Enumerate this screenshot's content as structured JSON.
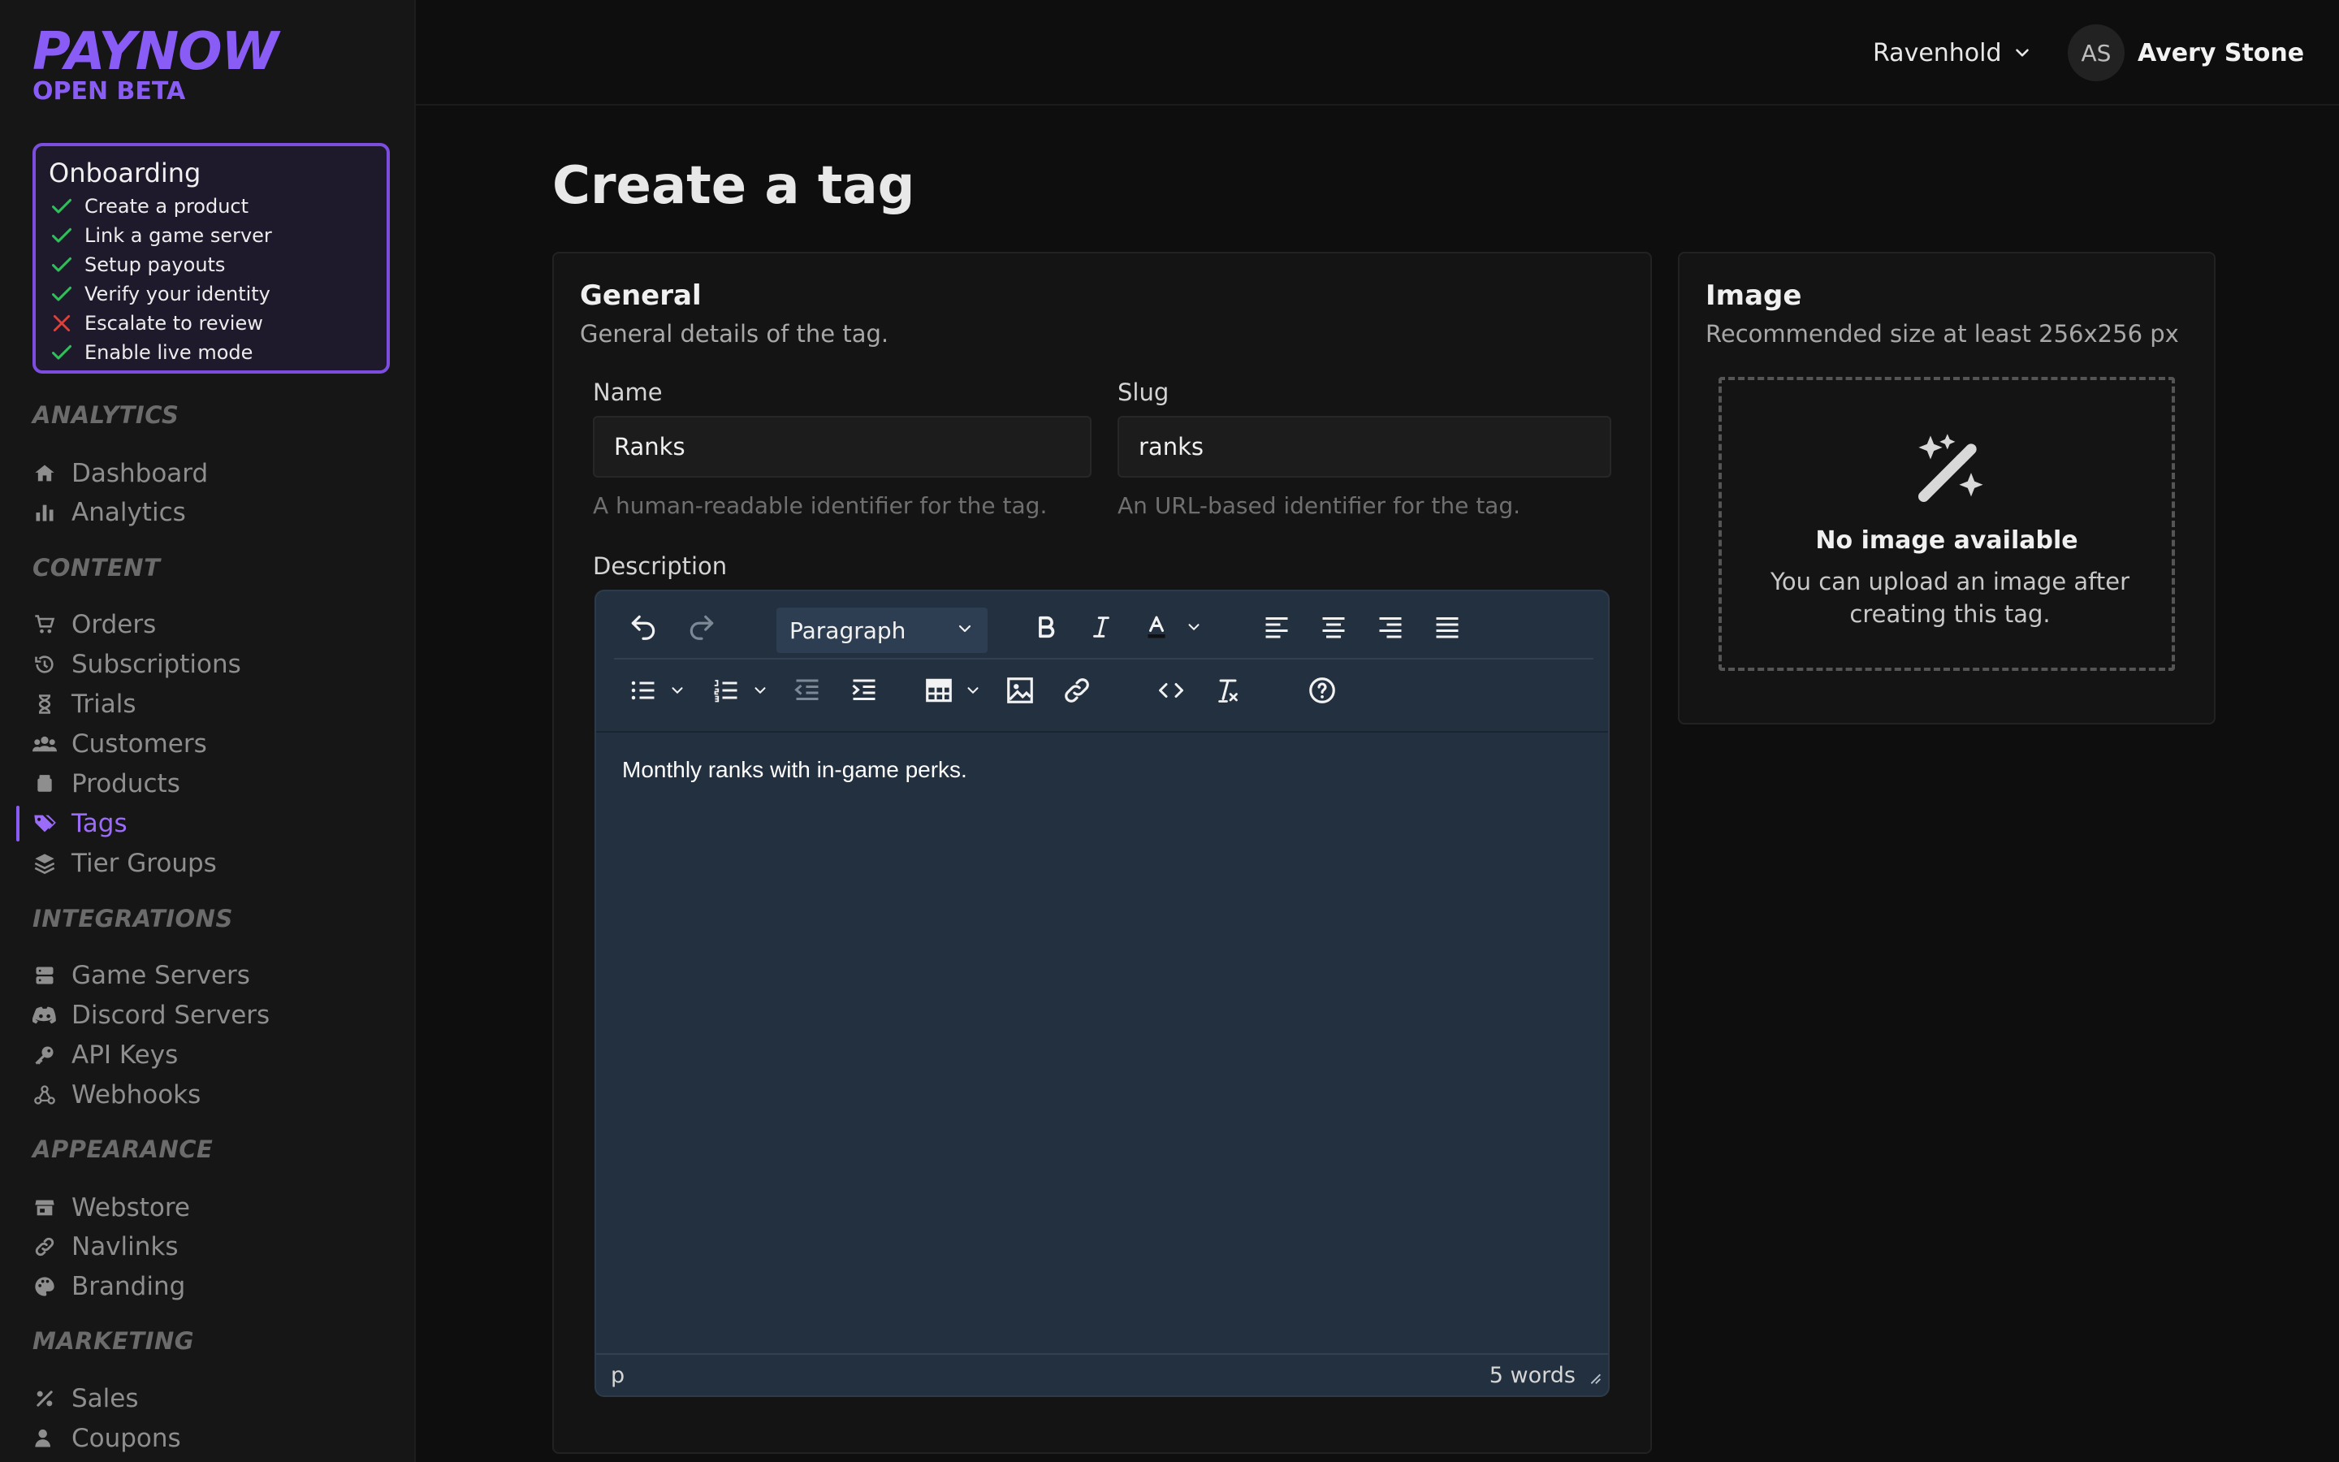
{
  "sidebar": {
    "logo": {
      "main": "PAYNOW",
      "sub": "OPEN BETA"
    },
    "onboarding": {
      "title": "Onboarding",
      "items": [
        {
          "label": "Create a product",
          "done": true
        },
        {
          "label": "Link a game server",
          "done": true
        },
        {
          "label": "Setup payouts",
          "done": true
        },
        {
          "label": "Verify your identity",
          "done": true
        },
        {
          "label": "Escalate to review",
          "done": false
        },
        {
          "label": "Enable live mode",
          "done": true
        }
      ]
    },
    "sections": {
      "analytics": "ANALYTICS",
      "content": "CONTENT",
      "integrations": "INTEGRATIONS",
      "appearance": "APPEARANCE",
      "marketing": "MARKETING"
    },
    "items": {
      "dashboard": "Dashboard",
      "analytics": "Analytics",
      "orders": "Orders",
      "subscriptions": "Subscriptions",
      "trials": "Trials",
      "customers": "Customers",
      "products": "Products",
      "tags": "Tags",
      "tier_groups": "Tier Groups",
      "game_servers": "Game Servers",
      "discord_servers": "Discord Servers",
      "api_keys": "API Keys",
      "webhooks": "Webhooks",
      "webstore": "Webstore",
      "navlinks": "Navlinks",
      "branding": "Branding",
      "sales": "Sales",
      "coupons": "Coupons"
    },
    "active_item": "Tags"
  },
  "header": {
    "store": "Ravenhold",
    "user_initials": "AS",
    "user_name": "Avery Stone"
  },
  "page": {
    "title": "Create a tag"
  },
  "general": {
    "title": "General",
    "subtitle": "General details of the tag.",
    "name_label": "Name",
    "name_value": "Ranks",
    "name_hint": "A human-readable identifier for the tag.",
    "slug_label": "Slug",
    "slug_value": "ranks",
    "slug_hint": "An URL-based identifier for the tag.",
    "description_label": "Description",
    "editor": {
      "block_format": "Paragraph",
      "content": "Monthly ranks with in-game perks.",
      "status_path": "p",
      "word_count": "5 words"
    }
  },
  "image": {
    "title": "Image",
    "subtitle": "Recommended size at least 256x256 px",
    "empty_title": "No image available",
    "empty_text": "You can upload an image after creating this tag."
  },
  "colors": {
    "accent": "#8a5cf6",
    "success": "#2fbf5a",
    "danger": "#e0403a",
    "editor_bg": "#22303f"
  }
}
